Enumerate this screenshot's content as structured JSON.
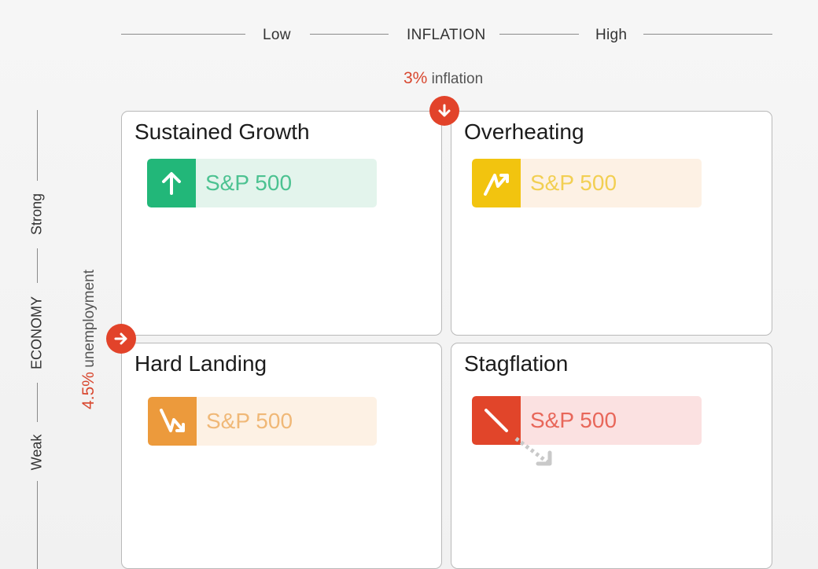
{
  "inflation_axis": {
    "low": "Low",
    "title": "INFLATION",
    "high": "High"
  },
  "economy_axis": {
    "strong": "Strong",
    "title": "ECONOMY",
    "weak": "Weak"
  },
  "inflation_threshold": {
    "value": "3%",
    "text": "inflation"
  },
  "unemployment_threshold": {
    "value": "4.5%",
    "text": "unemployment"
  },
  "quadrants": {
    "top_left": {
      "title": "Sustained Growth",
      "ticker": "S&P 500",
      "trend": "up",
      "color": "#22b779"
    },
    "top_right": {
      "title": "Overheating",
      "ticker": "S&P 500",
      "trend": "volatile-up",
      "color": "#f2c40f"
    },
    "bottom_left": {
      "title": "Hard Landing",
      "ticker": "S&P 500",
      "trend": "volatile-down",
      "color": "#ec9a3c"
    },
    "bottom_right": {
      "title": "Stagflation",
      "ticker": "S&P 500",
      "trend": "down",
      "color": "#e1452a"
    }
  }
}
